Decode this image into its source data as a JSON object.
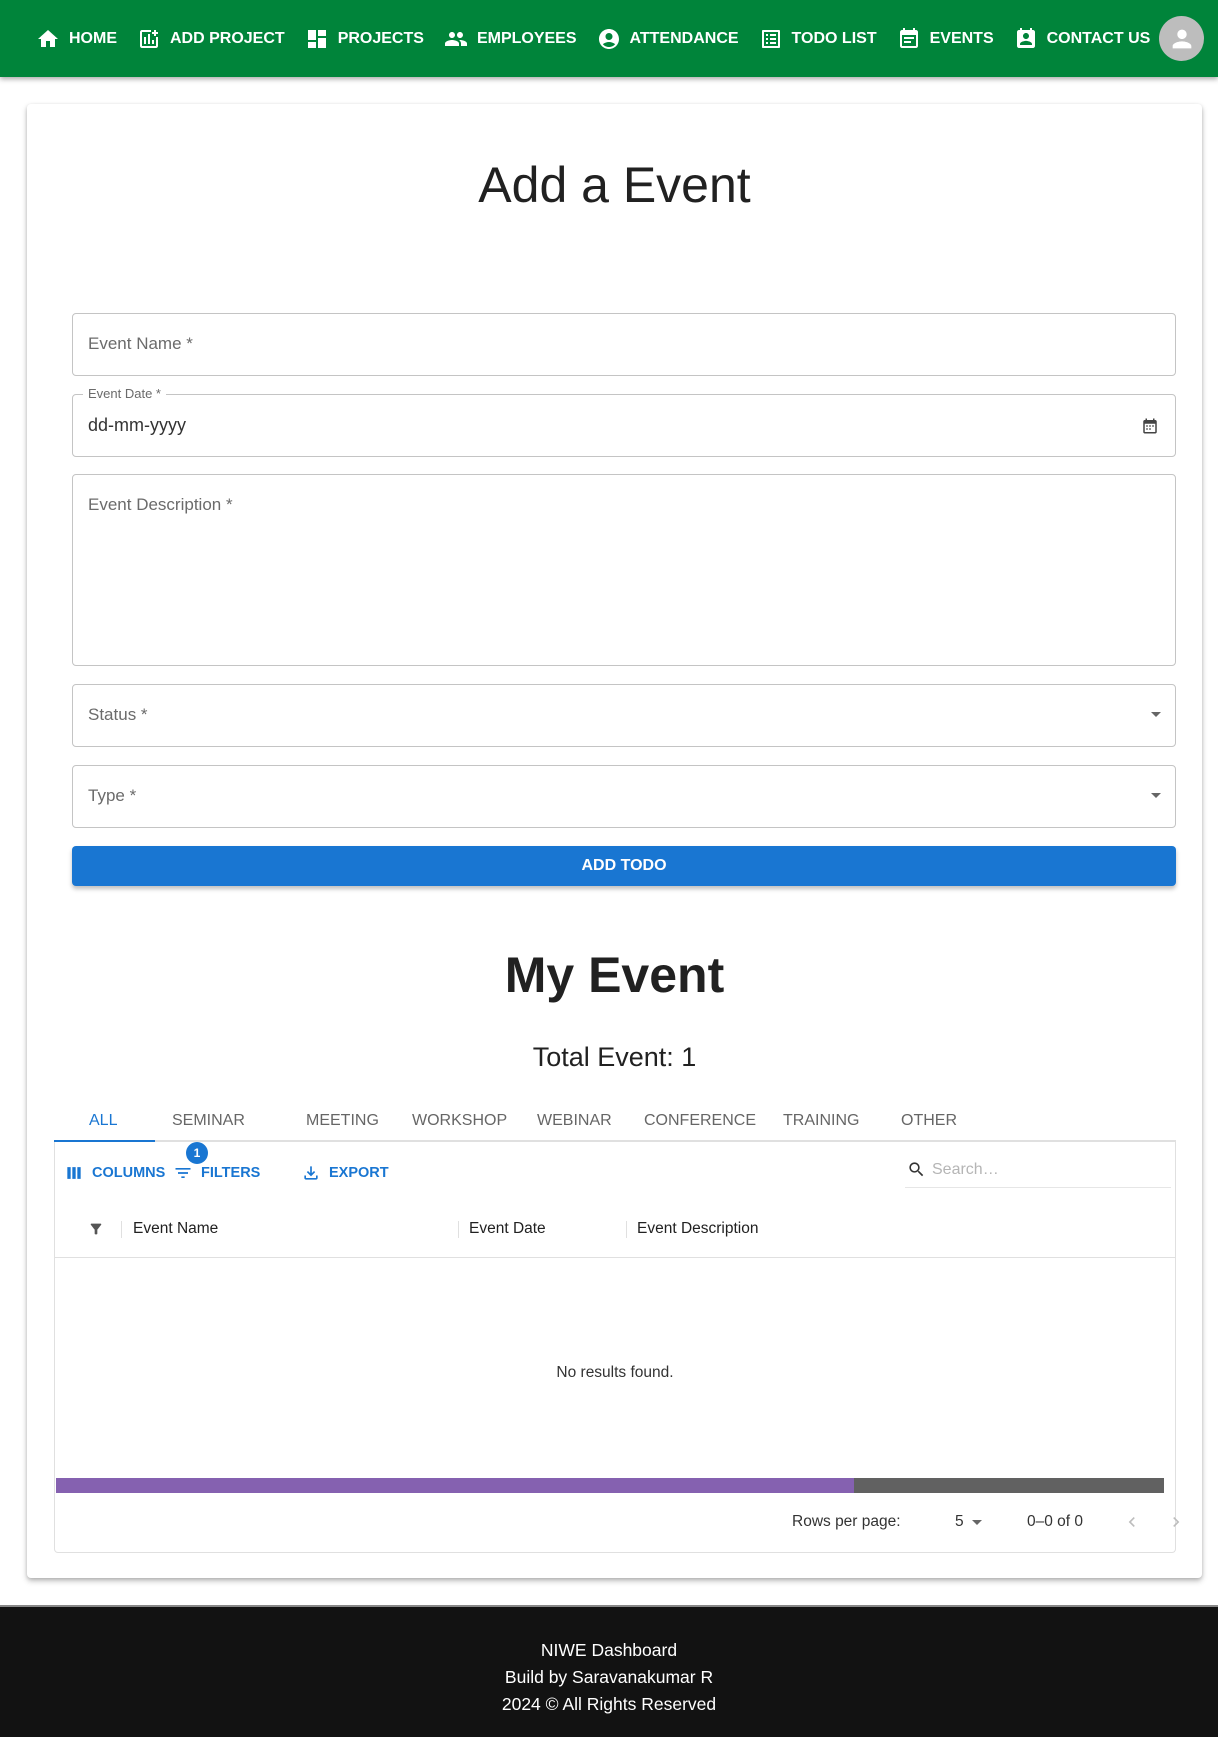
{
  "nav": {
    "items": [
      {
        "label": "HOME",
        "icon": "home-icon"
      },
      {
        "label": "ADD PROJECT",
        "icon": "add-chart-icon"
      },
      {
        "label": "PROJECTS",
        "icon": "dashboard-icon"
      },
      {
        "label": "EMPLOYEES",
        "icon": "people-icon"
      },
      {
        "label": "ATTENDANCE",
        "icon": "account-circle-icon"
      },
      {
        "label": "TODO LIST",
        "icon": "list-icon"
      },
      {
        "label": "EVENTS",
        "icon": "event-note-icon"
      },
      {
        "label": "CONTACT US",
        "icon": "contact-badge-icon"
      }
    ],
    "avatar_icon": "person-icon"
  },
  "form": {
    "title": "Add a Event",
    "event_name": {
      "placeholder": "Event Name *",
      "value": ""
    },
    "event_date": {
      "label": "Event Date *",
      "value": "dd-mm-yyyy"
    },
    "event_description": {
      "placeholder": "Event Description *",
      "value": ""
    },
    "status": {
      "placeholder": "Status *",
      "value": ""
    },
    "type": {
      "placeholder": "Type *",
      "value": ""
    },
    "submit_label": "ADD TODO"
  },
  "events": {
    "title": "My Event",
    "total_label": "Total Event: 1",
    "tabs": [
      "ALL",
      "SEMINAR",
      "MEETING",
      "WORKSHOP",
      "WEBINAR",
      "CONFERENCE",
      "TRAINING",
      "OTHER"
    ],
    "active_tab": "ALL",
    "toolbar": {
      "columns_label": "COLUMNS",
      "filters_label": "FILTERS",
      "filters_badge": "1",
      "export_label": "EXPORT",
      "search_placeholder": "Search…"
    },
    "columns": [
      "Event Name",
      "Event Date",
      "Event Description"
    ],
    "rows": [],
    "empty_message": "No results found.",
    "horizontal_scroll_fraction": 0.72,
    "pagination": {
      "rows_per_page_label": "Rows per page:",
      "rows_per_page": "5",
      "range": "0–0 of 0"
    }
  },
  "footer": {
    "line1": "NIWE Dashboard",
    "line2": "Build by Saravanakumar R",
    "line3": "2024 © All Rights Reserved"
  },
  "colors": {
    "navbar": "#00843a",
    "primary": "#1976d2",
    "scroll_thumb": "#8561b0",
    "footer_bg": "#121212"
  }
}
